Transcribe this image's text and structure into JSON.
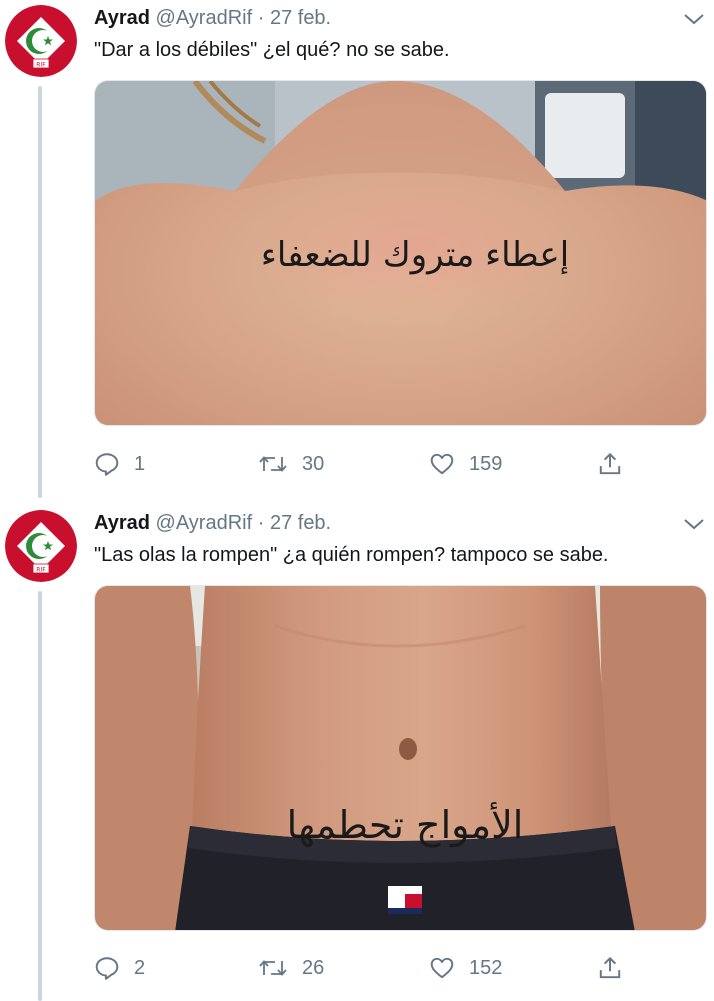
{
  "tweets": [
    {
      "author": {
        "name": "Ayrad",
        "handle": "@AyradRif",
        "separator": "·",
        "date": "27 feb."
      },
      "text": "\"Dar a los débiles\" ¿el qué? no se sabe.",
      "photo": {
        "tattoo_text": "إعطاء متروك للضعفاء",
        "subject": "upper-back tattoo"
      },
      "stats": {
        "replies": "1",
        "retweets": "30",
        "likes": "159"
      },
      "icons": {
        "reply": "reply-icon",
        "retweet": "retweet-icon",
        "like": "heart-icon",
        "share": "share-icon",
        "menu": "chevron-down-icon"
      }
    },
    {
      "author": {
        "name": "Ayrad",
        "handle": "@AyradRif",
        "separator": "·",
        "date": "27 feb."
      },
      "text": "\"Las olas la rompen\" ¿a quién rompen? tampoco se sabe.",
      "photo": {
        "tattoo_text": "الأمواج تحطمها",
        "subject": "stomach tattoo"
      },
      "stats": {
        "replies": "2",
        "retweets": "26",
        "likes": "152"
      },
      "icons": {
        "reply": "reply-icon",
        "retweet": "retweet-icon",
        "like": "heart-icon",
        "share": "share-icon",
        "menu": "chevron-down-icon"
      }
    }
  ],
  "avatar": {
    "badge_text": "RIF",
    "colors": {
      "red": "#c8102e",
      "white": "#ffffff",
      "green": "#2e8b3a"
    }
  },
  "colors": {
    "text": "#14171a",
    "secondary": "#657786",
    "thread_line": "#ccd6dd",
    "border": "#e1e8ed"
  }
}
